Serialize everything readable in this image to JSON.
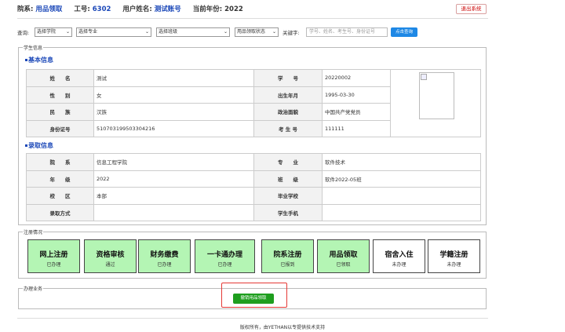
{
  "header": {
    "college_label": "院系:",
    "college_value": "用品领取",
    "id_label": "工号:",
    "id_value": "6302",
    "user_label": "用户姓名:",
    "user_value": "测试账号",
    "year_label": "当前年份:",
    "year_value": "2022",
    "logout_label": "退出系统"
  },
  "query": {
    "label": "查询:",
    "college_select": "选择学院",
    "major_select": "选择专业",
    "class_select": "选择班级",
    "status_select": "用品领取状态",
    "keyword_label": "关键字:",
    "keyword_placeholder": "学号、姓名、考生号、身份证号",
    "button_label": "点击查询"
  },
  "student": {
    "legend": "学生信息",
    "basic_title": "基本信息",
    "basic": {
      "name_k": "姓　　名",
      "name_v": "测试",
      "sid_k": "学　　号",
      "sid_v": "20220002",
      "gender_k": "性　　别",
      "gender_v": "女",
      "birth_k": "出生年月",
      "birth_v": "1995-03-30",
      "ethnic_k": "民　　族",
      "ethnic_v": "汉族",
      "political_k": "政治面貌",
      "political_v": "中国共产党党员",
      "idcard_k": "身份证号",
      "idcard_v": "510703199503304216",
      "exam_k": "考 生 号",
      "exam_v": "111111"
    },
    "admission_title": "录取信息",
    "admission": {
      "dept_k": "院　　系",
      "dept_v": "信息工程学院",
      "major_k": "专　　业",
      "major_v": "软件技术",
      "grade_k": "年　　级",
      "grade_v": "2022",
      "class_k": "班　　级",
      "class_v": "软件2022-05班",
      "campus_k": "校　　区",
      "campus_v": "本部",
      "school_k": "毕业学校",
      "school_v": "",
      "method_k": "录取方式",
      "method_v": "",
      "phone_k": "学生手机",
      "phone_v": ""
    }
  },
  "registration": {
    "legend": "注册情况",
    "items": [
      {
        "title": "网上注册",
        "status": "已办理"
      },
      {
        "title": "资格审核",
        "status": "通过"
      },
      {
        "title": "财务缴费",
        "status": "已办理"
      },
      {
        "title": "一卡通办理",
        "status": "已办理"
      },
      {
        "title": "院系注册",
        "status": "已报到"
      },
      {
        "title": "用品领取",
        "status": "已领取"
      },
      {
        "title": "宿舍入住",
        "status": "未办理"
      },
      {
        "title": "学籍注册",
        "status": "未办理"
      }
    ]
  },
  "business": {
    "legend": "办理业务",
    "action_label": "撤销用品领取"
  },
  "footer": {
    "text": "版权所有，由YETHAN以专提供技术支持"
  },
  "colors": {
    "accent": "#1a47b8",
    "done": "#b4f5b4",
    "action": "#1e9e1e",
    "highlight": "#e53935"
  }
}
